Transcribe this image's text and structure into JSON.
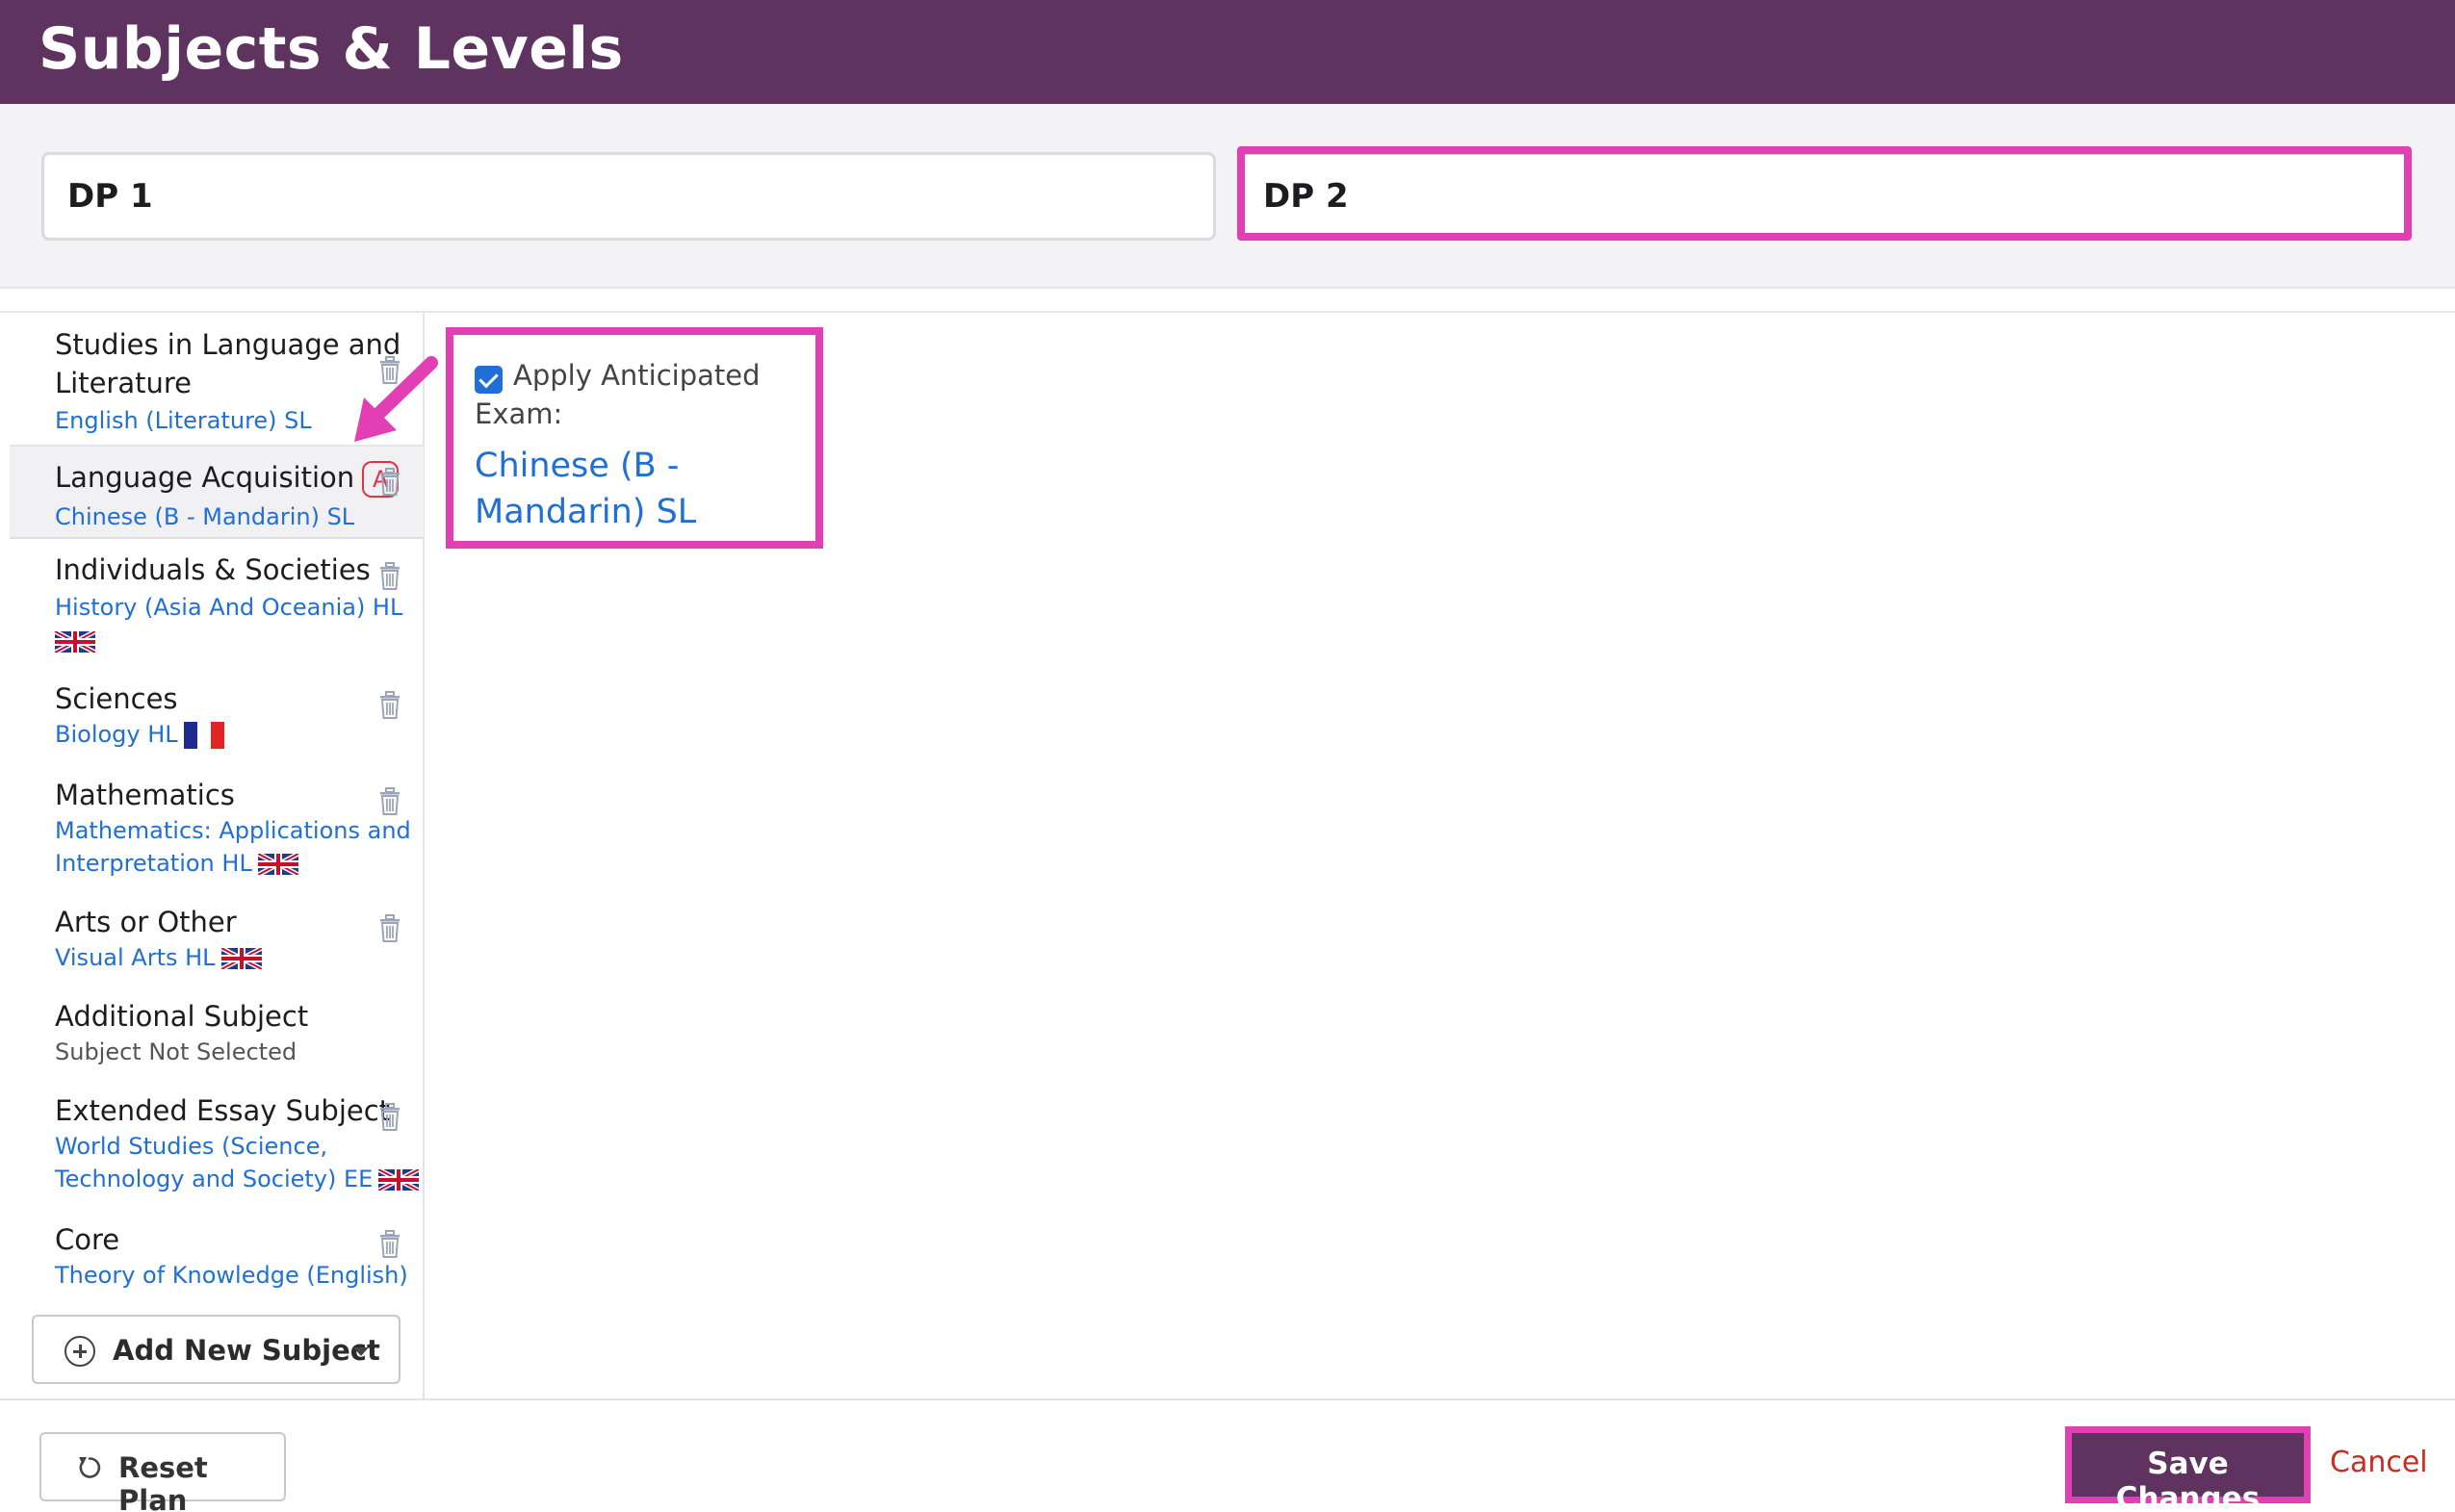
{
  "header": {
    "title": "Subjects & Levels"
  },
  "tabs": [
    {
      "label": "DP 1"
    },
    {
      "label": "DP 2"
    }
  ],
  "sidebar": {
    "items": [
      {
        "title": "Studies in Language and",
        "title2": "Literature",
        "subject": "English (Literature) SL",
        "flag": ""
      },
      {
        "title": "Language Acquisition",
        "badge": "A",
        "subject": "Chinese (B - Mandarin) SL",
        "flag": ""
      },
      {
        "title": "Individuals & Societies",
        "subject": "History (Asia And Oceania) HL",
        "flag": "uk-flag-icon"
      },
      {
        "title": "Sciences",
        "subject": "Biology HL",
        "flag": "france-flag-icon"
      },
      {
        "title": "Mathematics",
        "subject": "Mathematics: Applications and",
        "subject2": "Interpretation HL",
        "flag": "uk-flag-icon"
      },
      {
        "title": "Arts or Other",
        "subject": "Visual Arts HL",
        "flag": "uk-flag-icon"
      },
      {
        "title": "Additional Subject",
        "subject": "Subject Not Selected",
        "flag": ""
      },
      {
        "title": "Extended Essay Subject",
        "subject": "World Studies (Science,",
        "subject2": "Technology and Society) EE",
        "flag": "uk-flag-icon"
      },
      {
        "title": "Core",
        "subject": "Theory of Knowledge (English)",
        "flag": ""
      }
    ],
    "add_button": "Add New Subject"
  },
  "detail": {
    "checkbox_label": "Apply Anticipated",
    "checkbox_label2": "Exam:",
    "checked": true,
    "subject_link": "Chinese (B -",
    "subject_link2": "Mandarin) SL"
  },
  "footer": {
    "reset_label": "Reset Plan",
    "save_label": "Save Changes",
    "cancel_label": "Cancel"
  },
  "colors": {
    "brand": "#5e3360",
    "highlight": "#e23fb4",
    "link": "#1f6fd6",
    "danger": "#cc2b1f"
  }
}
